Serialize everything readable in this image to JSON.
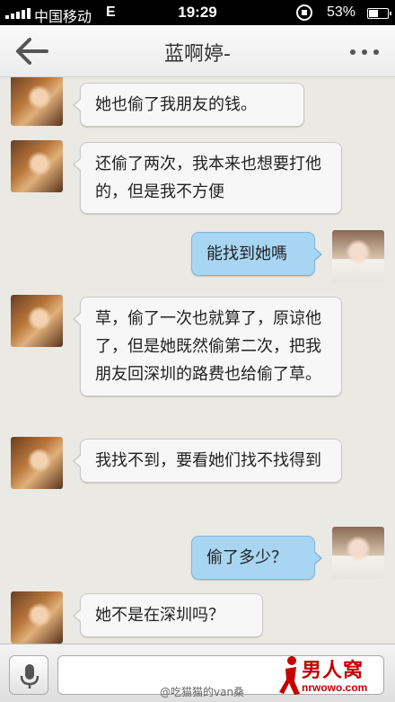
{
  "status_bar": {
    "carrier": "中国移动",
    "network": "E",
    "time": "19:29",
    "battery_percent": "53%",
    "battery_level": 0.53
  },
  "header": {
    "title": "蓝啊婷-",
    "back_icon": "arrow-left-icon",
    "more_icon": "more-dots-icon"
  },
  "messages": [
    {
      "side": "left",
      "text": "她也偷了我朋友的钱。"
    },
    {
      "side": "left",
      "text": "还偷了两次，我本来也想要打他的，但是我不方便"
    },
    {
      "side": "right",
      "text": "能找到她嗎"
    },
    {
      "side": "left",
      "text": "草，偷了一次也就算了，原谅他了，但是她既然偷第二次，把我朋友回深圳的路费也给偷了草。"
    },
    {
      "side": "left",
      "text": "我找不到，要看她们找不找得到"
    },
    {
      "side": "right",
      "text": "偷了多少？"
    },
    {
      "side": "left",
      "text": "她不是在深圳吗？"
    }
  ],
  "input_bar": {
    "voice_icon": "microphone-icon",
    "input_value": ""
  },
  "watermark": {
    "text": "@吃猫猫的van桑",
    "logo_brand": "男人窝",
    "logo_domain": "nrwowo.com"
  },
  "colors": {
    "right_bubble": "#a8d6f2",
    "left_bubble": "#f7f7f7",
    "logo_red": "#c40000"
  }
}
